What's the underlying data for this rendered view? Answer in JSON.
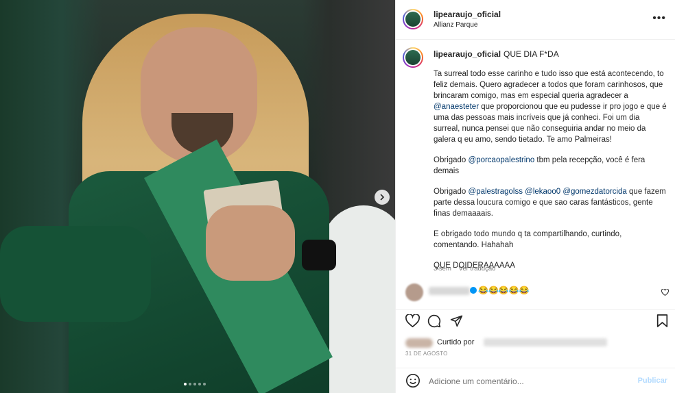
{
  "post": {
    "username": "lipearaujo_oficial",
    "location": "Allianz Parque",
    "more_icon": "more-horizontal-icon"
  },
  "carousel": {
    "slide_count": 5,
    "active_index": 0,
    "next_icon": "chevron-right-icon"
  },
  "caption": {
    "username": "lipearaujo_oficial",
    "title": "QUE DIA F*DA",
    "p1": "Ta surreal todo esse carinho e tudo isso que está acontecendo, to feliz demais. Quero agradecer a todos que foram carinhosos, que brincaram comigo, mas em especial queria agradecer a ",
    "p1_mention": "@anaesteter",
    "p1_rest": " que proporcionou que eu pudesse ir pro jogo e que é uma das pessoas mais incríveis que já conheci. Foi um dia surreal, nunca pensei que não conseguiria andar no meio da galera q eu amo, sendo tietado. Te amo Palmeiras!",
    "p2_a": "Obrigado ",
    "p2_mention": "@porcaopalestrino",
    "p2_rest": " tbm pela recepção, você é fera demais",
    "p3_a": "Obrigado ",
    "p3_m1": "@palestragolss",
    "p3_m2": "@lekaoo0",
    "p3_m3": "@gomezdatorcida",
    "p3_rest": " que fazem parte dessa loucura comigo e que sao caras fantásticos, gente finas demaaaais.",
    "p4": "E obrigado todo mundo q ta compartilhando, curtindo, comentando. Hahahah",
    "p5": "QUE DOIDERAAAAAA",
    "time": "3 sem",
    "translate": "Ver tradução"
  },
  "comment": {
    "text": "😂😂😂😂😂",
    "heart_icon": "heart-outline-icon"
  },
  "actions": {
    "like_icon": "heart-outline-icon",
    "comment_icon": "comment-icon",
    "share_icon": "send-icon",
    "save_icon": "bookmark-icon"
  },
  "likes": {
    "text": "Curtido por",
    "date": "31 DE AGOSTO"
  },
  "add_comment": {
    "placeholder": "Adicione um comentário...",
    "publish": "Publicar",
    "emoji_icon": "smiley-icon"
  }
}
